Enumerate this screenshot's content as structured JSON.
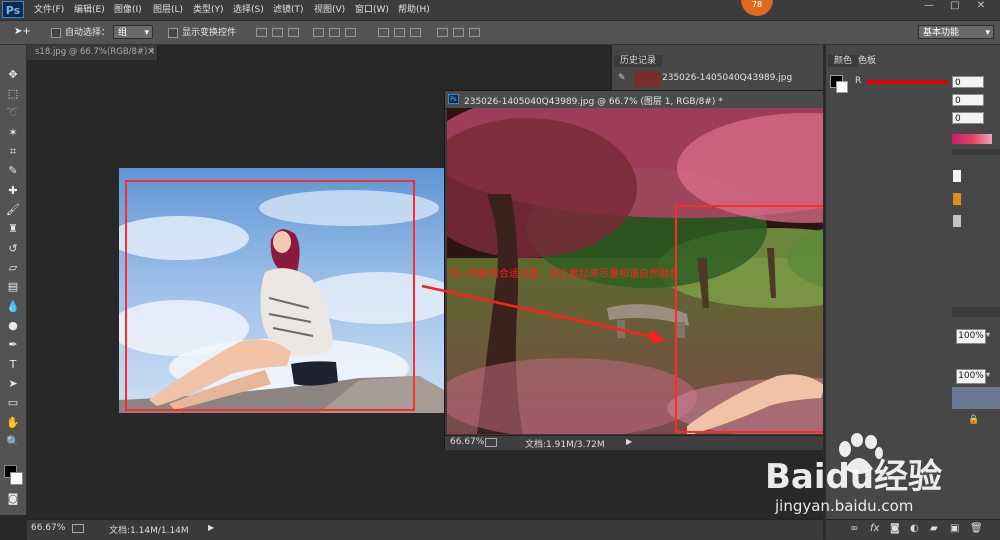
{
  "app": {
    "logo": "Ps",
    "badge": "78"
  },
  "menu": [
    "文件(F)",
    "编辑(E)",
    "图像(I)",
    "图层(L)",
    "类型(Y)",
    "选择(S)",
    "滤镜(T)",
    "视图(V)",
    "窗口(W)",
    "帮助(H)"
  ],
  "window_controls": [
    "—",
    "□",
    "✕"
  ],
  "options": {
    "auto_select_label": "自动选择：",
    "auto_select_value": "组",
    "show_transform_label": "显示变换控件",
    "workspace": "基本功能"
  },
  "tools": [
    "move-tool",
    "marquee-tool",
    "lasso-tool",
    "magic-wand-tool",
    "crop-tool",
    "eyedropper-tool",
    "healing-tool",
    "brush-tool",
    "stamp-tool",
    "history-brush-tool",
    "eraser-tool",
    "gradient-tool",
    "blur-tool",
    "dodge-tool",
    "pen-tool",
    "type-tool",
    "path-select-tool",
    "shape-tool",
    "hand-tool",
    "zoom-tool"
  ],
  "doc_tab": {
    "title": "s18.jpg @ 66.7%(RGB/8#) *",
    "close": "×"
  },
  "float_window": {
    "icon": "Ps",
    "title": "235026-1405040Q43989.jpg @ 66.7% (图层 1, RGB/8#) *",
    "zoom": "66.67%",
    "doc_info": "文档:1.91M/3.72M"
  },
  "status": {
    "zoom": "66.67%",
    "doc_info": "文档:1.14M/1.14M"
  },
  "history_panel": {
    "tab": "历史记录",
    "snapshot": "235026-1405040Q43989.jpg"
  },
  "color_panel": {
    "tabs": [
      "颜色",
      "色板"
    ],
    "r_label": "R",
    "values": [
      "0",
      "0",
      "0"
    ],
    "opacity": "100%",
    "fill": "100%"
  },
  "annotation": "将人物拖到合适位置，使之看起来尽量和谐自然融合",
  "watermark": {
    "brand": "Baidu经验",
    "url": "jingyan.baidu.com"
  },
  "colors": {
    "annotation_red": "#ff1e1e",
    "panel": "#474747",
    "menubar": "#3c3c3c"
  }
}
